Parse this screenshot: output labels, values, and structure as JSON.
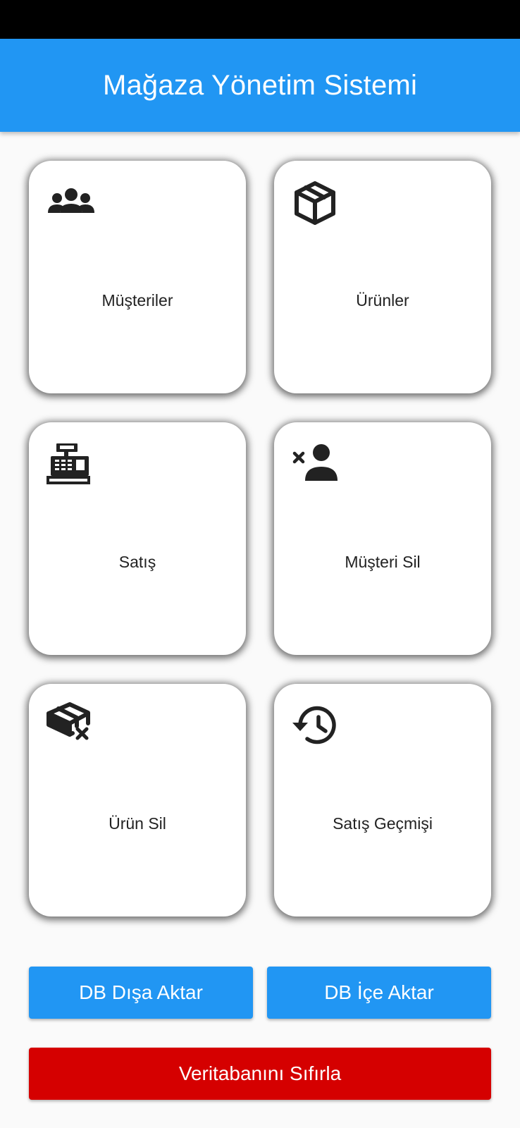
{
  "app_bar": {
    "title": "Mağaza Yönetim Sistemi"
  },
  "menu": {
    "cards": [
      {
        "label": "Müşteriler",
        "icon": "people-icon"
      },
      {
        "label": "Ürünler",
        "icon": "box-icon"
      },
      {
        "label": "Satış",
        "icon": "cash-register-icon"
      },
      {
        "label": "Müşteri Sil",
        "icon": "remove-user-icon"
      },
      {
        "label": "Ürün Sil",
        "icon": "remove-box-icon"
      },
      {
        "label": "Satış Geçmişi",
        "icon": "history-icon"
      }
    ]
  },
  "actions": {
    "export_label": "DB Dışa Aktar",
    "import_label": "DB İçe Aktar",
    "reset_label": "Veritabanını Sıfırla"
  },
  "colors": {
    "primary": "#2196f3",
    "danger": "#d50000",
    "status_bar": "#000000",
    "background": "#fafafa"
  }
}
